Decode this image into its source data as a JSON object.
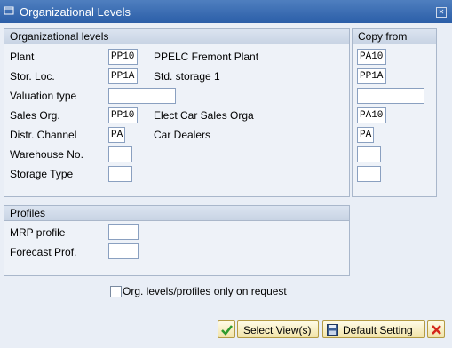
{
  "window": {
    "title": "Organizational Levels"
  },
  "org_panel": {
    "title": "Organizational levels",
    "rows": [
      {
        "label": "Plant",
        "value": "PP10",
        "desc": "PPELC Fremont Plant",
        "copy": "PA10"
      },
      {
        "label": "Stor. Loc.",
        "value": "PP1A",
        "desc": "Std. storage 1",
        "copy": "PP1A"
      },
      {
        "label": "Valuation type",
        "value": "",
        "desc": "",
        "copy": ""
      },
      {
        "label": "Sales Org.",
        "value": "PP10",
        "desc": "Elect Car Sales Orga",
        "copy": "PA10"
      },
      {
        "label": "Distr. Channel",
        "value": "PA",
        "desc": "Car Dealers",
        "copy": "PA"
      },
      {
        "label": "Warehouse No.",
        "value": "",
        "desc": "",
        "copy": ""
      },
      {
        "label": "Storage Type",
        "value": "",
        "desc": "",
        "copy": ""
      }
    ]
  },
  "copy_panel": {
    "title": "Copy from"
  },
  "profiles_panel": {
    "title": "Profiles",
    "rows": [
      {
        "label": "MRP profile",
        "value": ""
      },
      {
        "label": "Forecast Prof.",
        "value": ""
      }
    ]
  },
  "option": {
    "label": "Org. levels/profiles only on request",
    "checked": false
  },
  "buttons": {
    "confirm_icon": "check-icon",
    "select_views": "Select View(s)",
    "default_setting": "Default Setting",
    "cancel_icon": "cancel-icon"
  },
  "colors": {
    "title_bar": "#2b5ea8",
    "button_bg": "#f1e3a8",
    "cancel_red": "#d4281c",
    "confirm_green": "#2e9a2e"
  }
}
